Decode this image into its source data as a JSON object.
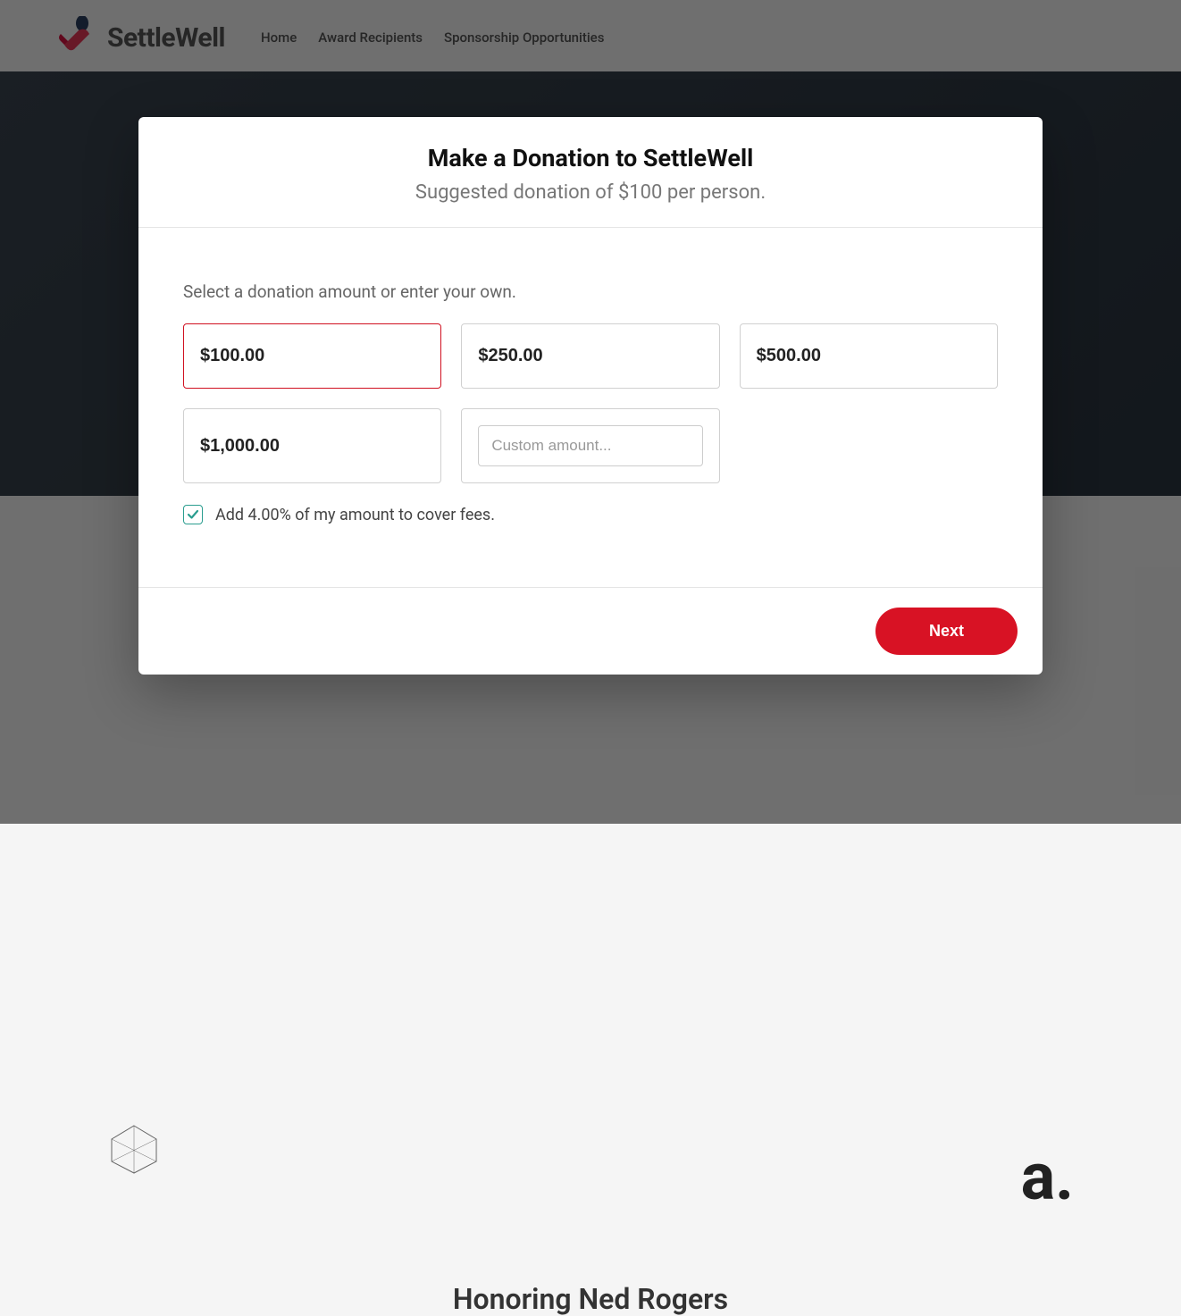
{
  "header": {
    "brand": "SettleWell",
    "nav": [
      {
        "label": "Home"
      },
      {
        "label": "Award Recipients"
      },
      {
        "label": "Sponsorship Opportunities"
      }
    ]
  },
  "background": {
    "tagline_fragment": "a.",
    "honoring": "Honoring Ned Rogers"
  },
  "modal": {
    "title": "Make a Donation to SettleWell",
    "subtitle": "Suggested donation of $100 per person.",
    "instruction": "Select a donation amount or enter your own.",
    "amounts": [
      {
        "label": "$100.00",
        "selected": true
      },
      {
        "label": "$250.00",
        "selected": false
      },
      {
        "label": "$500.00",
        "selected": false
      },
      {
        "label": "$1,000.00",
        "selected": false
      }
    ],
    "custom_placeholder": "Custom amount...",
    "fee_checkbox": {
      "checked": true,
      "label": "Add 4.00% of my amount to cover fees."
    },
    "next_label": "Next"
  },
  "colors": {
    "accent_red": "#d81224",
    "accent_teal": "#2a9d8f"
  }
}
